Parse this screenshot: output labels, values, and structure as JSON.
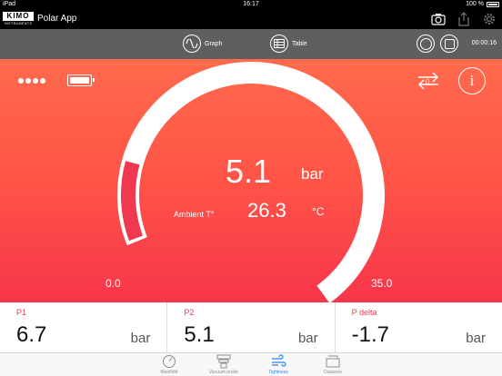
{
  "status_bar": {
    "device": "iPad",
    "time": "16:17",
    "battery": "100 %"
  },
  "header": {
    "brand": "KIMO",
    "brand_sub": "INSTRUMENTS",
    "title": "Polar App",
    "icons": [
      "camera-icon",
      "share-icon",
      "gear-icon"
    ]
  },
  "toolbar": {
    "graph_label": "Graph",
    "table_label": "Table",
    "timer": "00:00:16"
  },
  "gauge": {
    "value": "5.1",
    "unit": "bar",
    "ambient_label": "Ambient T°",
    "ambient_value": "26.3",
    "ambient_unit": "°C",
    "min": "0.0",
    "max": "35.0",
    "level_fraction": 0.146,
    "colors": {
      "track": "#ffffff",
      "fill": "#f0384f"
    }
  },
  "readouts": [
    {
      "label": "P1",
      "value": "6.7",
      "unit": "bar"
    },
    {
      "label": "P2",
      "value": "5.1",
      "unit": "bar"
    },
    {
      "label": "P delta",
      "value": "-1.7",
      "unit": "bar"
    }
  ],
  "tabs": [
    {
      "label": "Manifold",
      "icon": "gauge-icon",
      "active": false
    },
    {
      "label": "Vacuum probe",
      "icon": "vacuum-probe-icon",
      "active": false
    },
    {
      "label": "Tightness",
      "icon": "wind-icon",
      "active": true
    },
    {
      "label": "Datasets",
      "icon": "folder-icon",
      "active": false
    }
  ],
  "colors": {
    "accent": "#f0384f",
    "active_tab": "#2a86f0",
    "toolbar": "#5f5f60"
  }
}
